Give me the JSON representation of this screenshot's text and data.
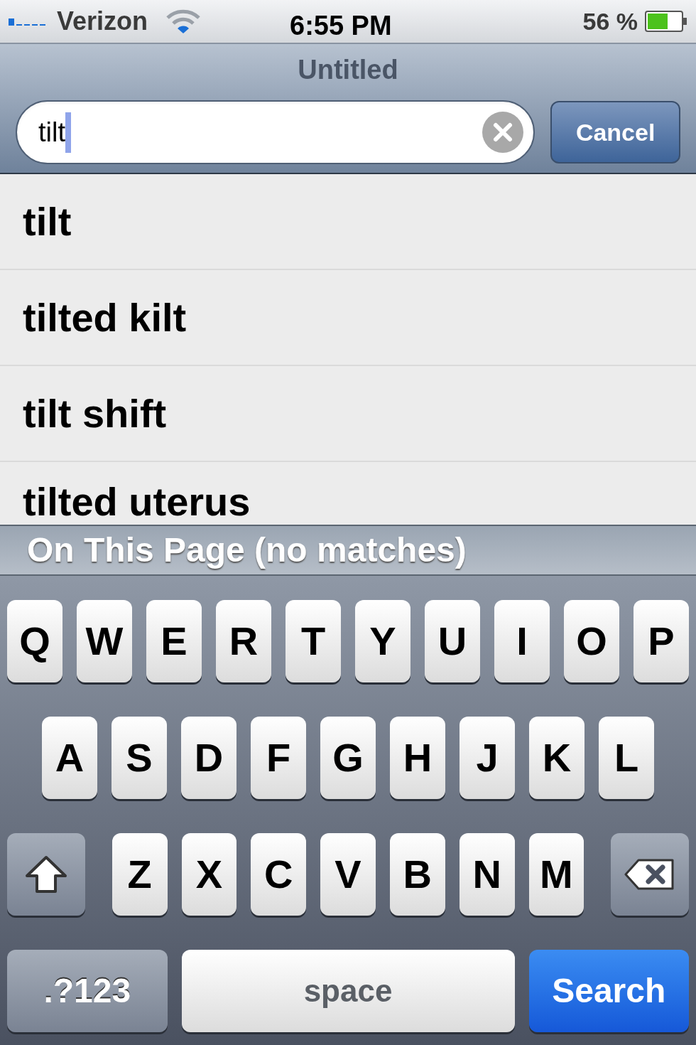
{
  "status_bar": {
    "carrier": "Verizon",
    "time": "6:55 PM",
    "battery": "56 %"
  },
  "title": "Untitled",
  "search": {
    "value": "tilt"
  },
  "cancel_button": "Cancel",
  "suggestions": [
    "tilt",
    "tilted kilt",
    "tilt shift",
    "tilted uterus"
  ],
  "section_header": "On This Page (no matches)",
  "keyboard": {
    "rows": [
      [
        {
          "kind": "letter",
          "label": "Q"
        },
        {
          "kind": "letter",
          "label": "W"
        },
        {
          "kind": "letter",
          "label": "E"
        },
        {
          "kind": "letter",
          "label": "R"
        },
        {
          "kind": "letter",
          "label": "T"
        },
        {
          "kind": "letter",
          "label": "Y"
        },
        {
          "kind": "letter",
          "label": "U"
        },
        {
          "kind": "letter",
          "label": "I"
        },
        {
          "kind": "letter",
          "label": "O"
        },
        {
          "kind": "letter",
          "label": "P"
        }
      ],
      [
        {
          "kind": "letter",
          "label": "A"
        },
        {
          "kind": "letter",
          "label": "S"
        },
        {
          "kind": "letter",
          "label": "D"
        },
        {
          "kind": "letter",
          "label": "F"
        },
        {
          "kind": "letter",
          "label": "G"
        },
        {
          "kind": "letter",
          "label": "H"
        },
        {
          "kind": "letter",
          "label": "J"
        },
        {
          "kind": "letter",
          "label": "K"
        },
        {
          "kind": "letter",
          "label": "L"
        }
      ],
      [
        {
          "kind": "shift"
        },
        {
          "kind": "letter",
          "label": "Z"
        },
        {
          "kind": "letter",
          "label": "X"
        },
        {
          "kind": "letter",
          "label": "C"
        },
        {
          "kind": "letter",
          "label": "V"
        },
        {
          "kind": "letter",
          "label": "B"
        },
        {
          "kind": "letter",
          "label": "N"
        },
        {
          "kind": "letter",
          "label": "M"
        },
        {
          "kind": "delete"
        }
      ]
    ],
    "bottom_keys": [
      {
        "kind": "mode",
        "label": ".?123"
      },
      {
        "kind": "space",
        "label": "space"
      },
      {
        "kind": "action",
        "label": "Search"
      }
    ]
  }
}
